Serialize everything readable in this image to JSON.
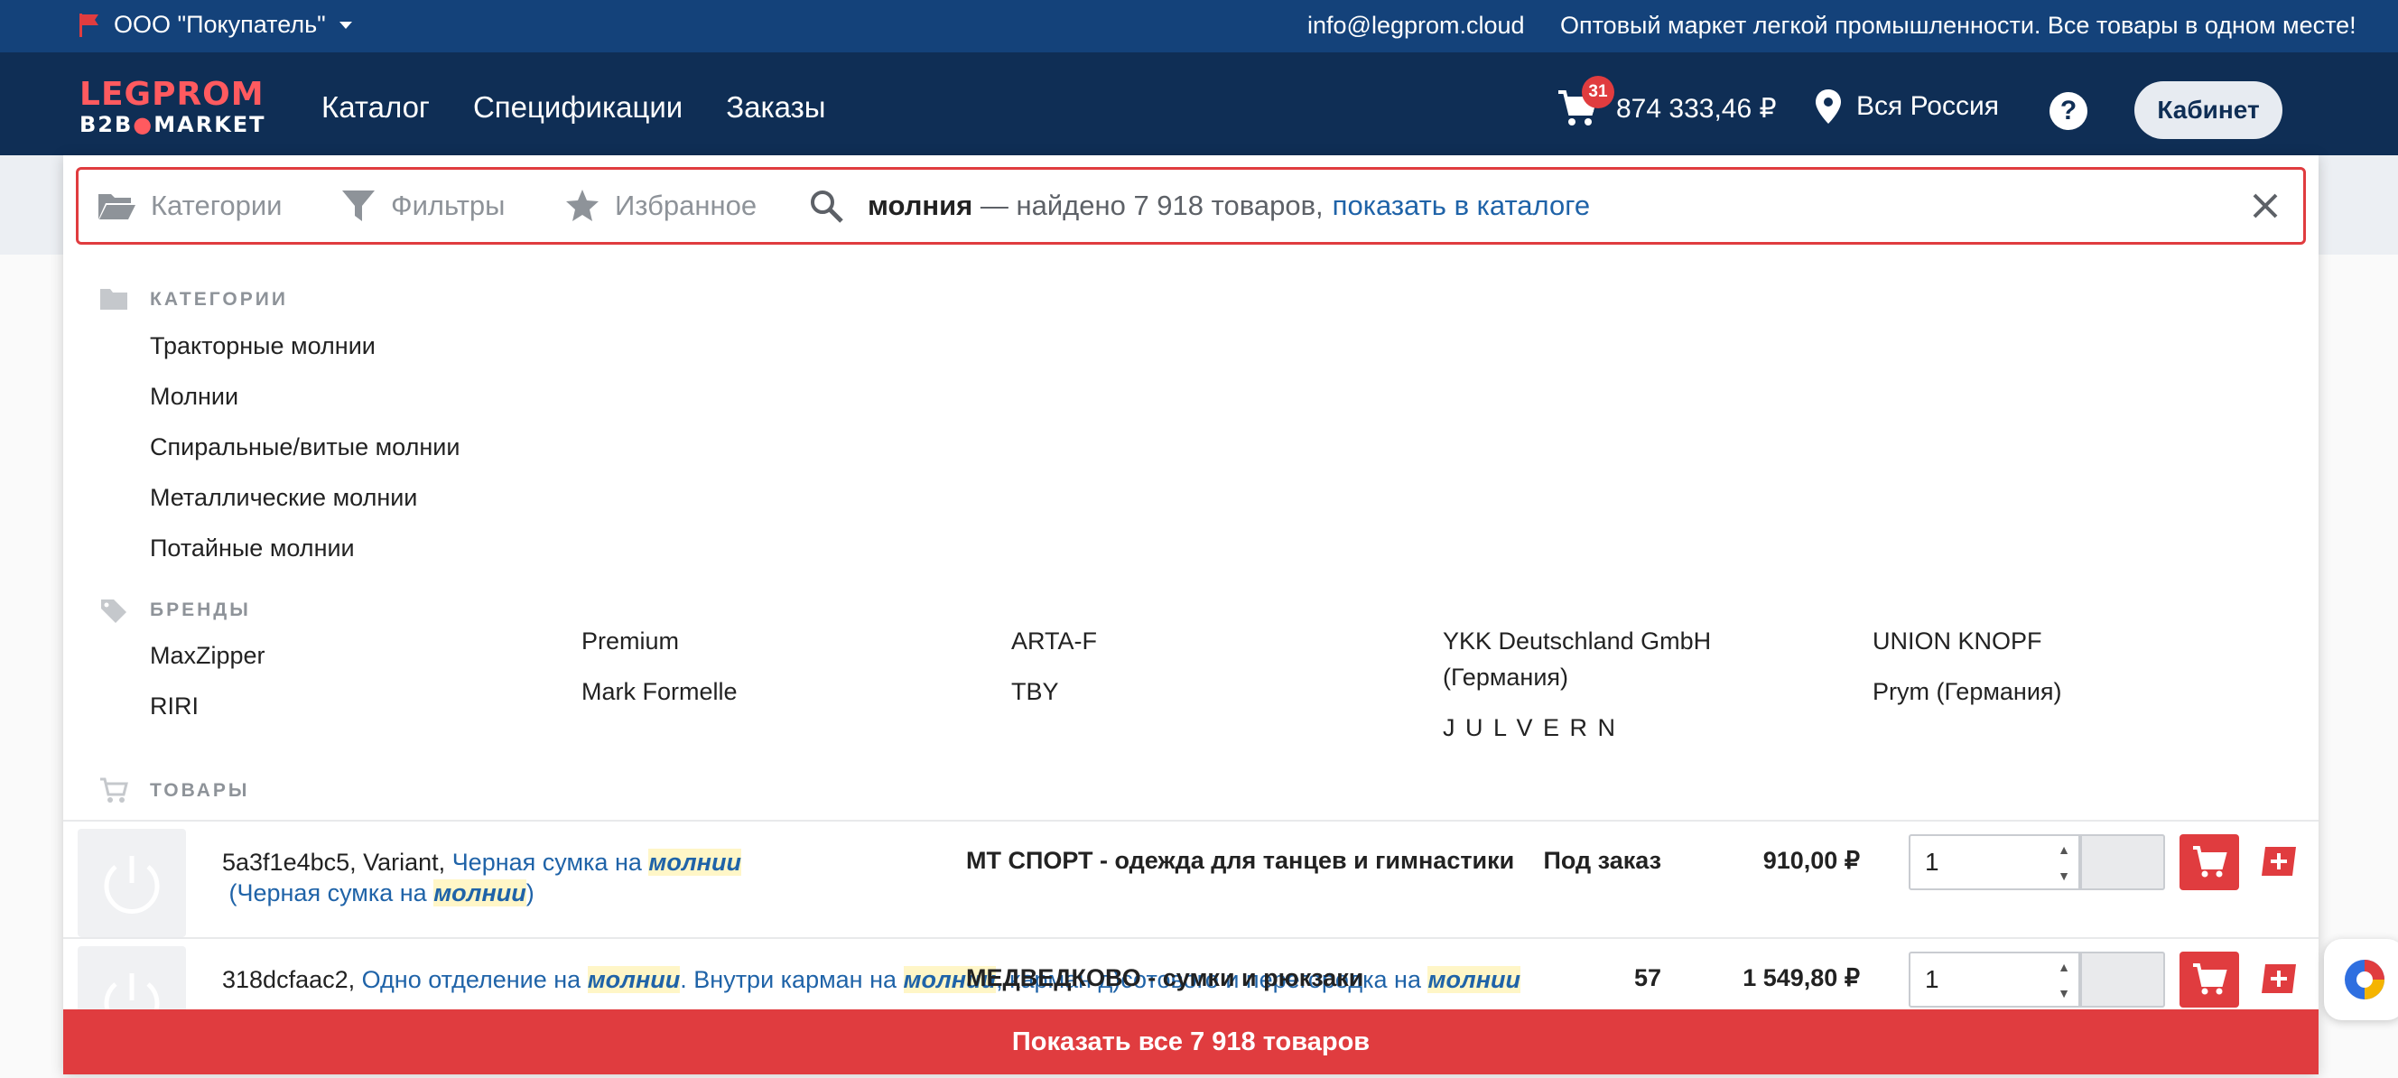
{
  "topbar": {
    "company": "ООО \"Покупатель\"",
    "email": "info@legprom.cloud",
    "tagline": "Оптовый маркет легкой промышленности. Все товары в одном месте!"
  },
  "header": {
    "logo_line1": "LEGPROM",
    "logo_line2": "B2B",
    "logo_line3": "MARKET",
    "nav": [
      "Каталог",
      "Спецификации",
      "Заказы"
    ],
    "cart_count": "31",
    "cart_total": "874 333,46 ₽",
    "region": "Вся Россия",
    "help": "?",
    "cabinet": "Кабинет"
  },
  "search": {
    "categories_tab": "Категории",
    "filters_tab": "Фильтры",
    "favorites_tab": "Избранное",
    "query": "молния",
    "result_text": " — найдено 7 918 товаров,",
    "catalog_link": "показать в каталоге"
  },
  "categories": {
    "label": "КАТЕГОРИИ",
    "items": [
      "Тракторные молнии",
      "Молнии",
      "Спиральные/витые молнии",
      "Металлические молнии",
      "Потайные молнии"
    ]
  },
  "brands": {
    "label": "БРЕНДЫ",
    "columns": [
      [
        "MaxZipper",
        "RIRI"
      ],
      [
        "Premium",
        "Mark Formelle"
      ],
      [
        "ARTA-F",
        "TBY"
      ],
      [
        "YKK Deutschland GmbH (Германия)",
        "J U L V E R N"
      ],
      [
        "UNION KNOPF",
        "Prym (Германия)"
      ]
    ]
  },
  "products": {
    "label": "ТОВАРЫ",
    "rows": [
      {
        "id": "5a3f1e4bc5, Variant, ",
        "name_a": "Черная сумка на ",
        "hl1": "молнии",
        "name_b": " (Черная сумка на ",
        "hl2": "молнии",
        "name_c": ")",
        "supplier": "МТ СПОРТ - одежда для танцев и гимнастики",
        "availability": "Под заказ",
        "price": "910,00 ₽",
        "qty": "1"
      },
      {
        "id": "318dcfaac2, ",
        "name_a": "Одно отделение на ",
        "hl1": "молнии",
        "name_b": ". Внутри карман на ",
        "hl2": "молнии",
        "name_c": ", карман д)сотового и перегородка на ",
        "hl3": "молнии",
        "supplier": "МЕДВЕДКОВО - сумки и рюкзаки",
        "availability": "57",
        "price": "1 549,80 ₽",
        "qty": "1"
      }
    ]
  },
  "show_all": "Показать все 7 918 товаров",
  "colors": {
    "brand_red": "#e03c3f",
    "header_navy": "#0f2e55",
    "topbar_blue": "#14427a",
    "link": "#1f63a8"
  }
}
